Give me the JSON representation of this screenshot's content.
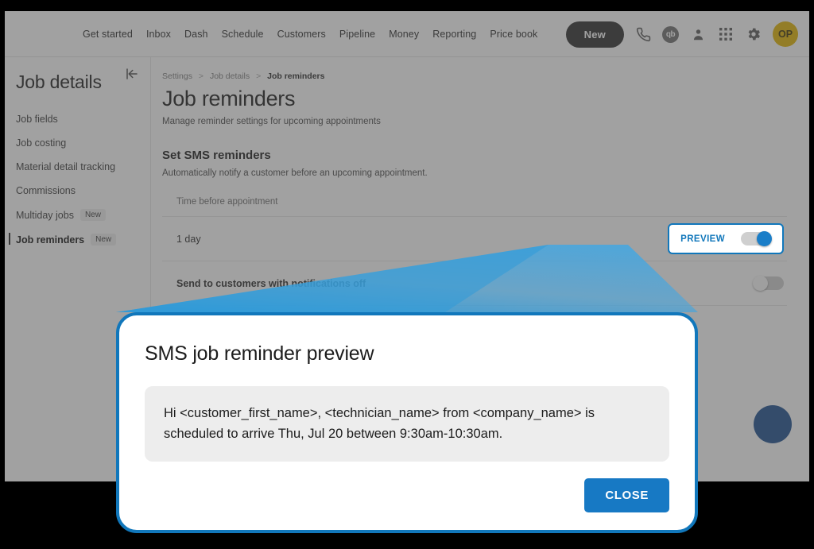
{
  "nav": {
    "links": [
      "Get started",
      "Inbox",
      "Dash",
      "Schedule",
      "Customers",
      "Pipeline",
      "Money",
      "Reporting",
      "Price book"
    ],
    "new_button": "New",
    "icons": [
      "phone-icon",
      "quickbooks-icon",
      "person-icon",
      "apps-grid-icon",
      "gear-icon"
    ],
    "quickbooks_label": "qb",
    "avatar_initials": "OP"
  },
  "sidebar": {
    "title": "Job details",
    "collapse_icon": "collapse-sidebar-icon",
    "items": [
      {
        "label": "Job fields",
        "badge": "",
        "active": false
      },
      {
        "label": "Job costing",
        "badge": "",
        "active": false
      },
      {
        "label": "Material detail tracking",
        "badge": "",
        "active": false
      },
      {
        "label": "Commissions",
        "badge": "",
        "active": false
      },
      {
        "label": "Multiday jobs",
        "badge": "New",
        "active": false
      },
      {
        "label": "Job reminders",
        "badge": "New",
        "active": true
      }
    ]
  },
  "main": {
    "breadcrumb": [
      "Settings",
      "Job details",
      "Job reminders"
    ],
    "breadcrumb_separator": ">",
    "page_title": "Job reminders",
    "page_subtitle": "Manage reminder settings for upcoming appointments",
    "section_title": "Set SMS reminders",
    "section_subtitle": "Automatically notify a customer before an upcoming appointment.",
    "column_header": "Time before appointment",
    "rows": [
      {
        "label": "1 day",
        "strong": false
      },
      {
        "label": "Send to customers with notifications off",
        "strong": true
      }
    ],
    "preview_label": "PREVIEW",
    "preview_toggle_state": "on",
    "second_toggle_state": "off",
    "fab": "floating-action-button"
  },
  "modal": {
    "title": "SMS job reminder preview",
    "message": "Hi <customer_first_name>, <technician_name> from <company_name> is scheduled to arrive Thu, Jul 20 between 9:30am-10:30am.",
    "close_label": "CLOSE"
  },
  "colors": {
    "accent_blue": "#1177bb",
    "button_blue": "#1779c4",
    "toggle_blue": "#1a7ec8",
    "avatar_gold": "#e2b500",
    "fab_blue": "#1d4e8f",
    "new_button_dark": "#2d2d2d",
    "beam_blue": "#3a9ad9"
  }
}
